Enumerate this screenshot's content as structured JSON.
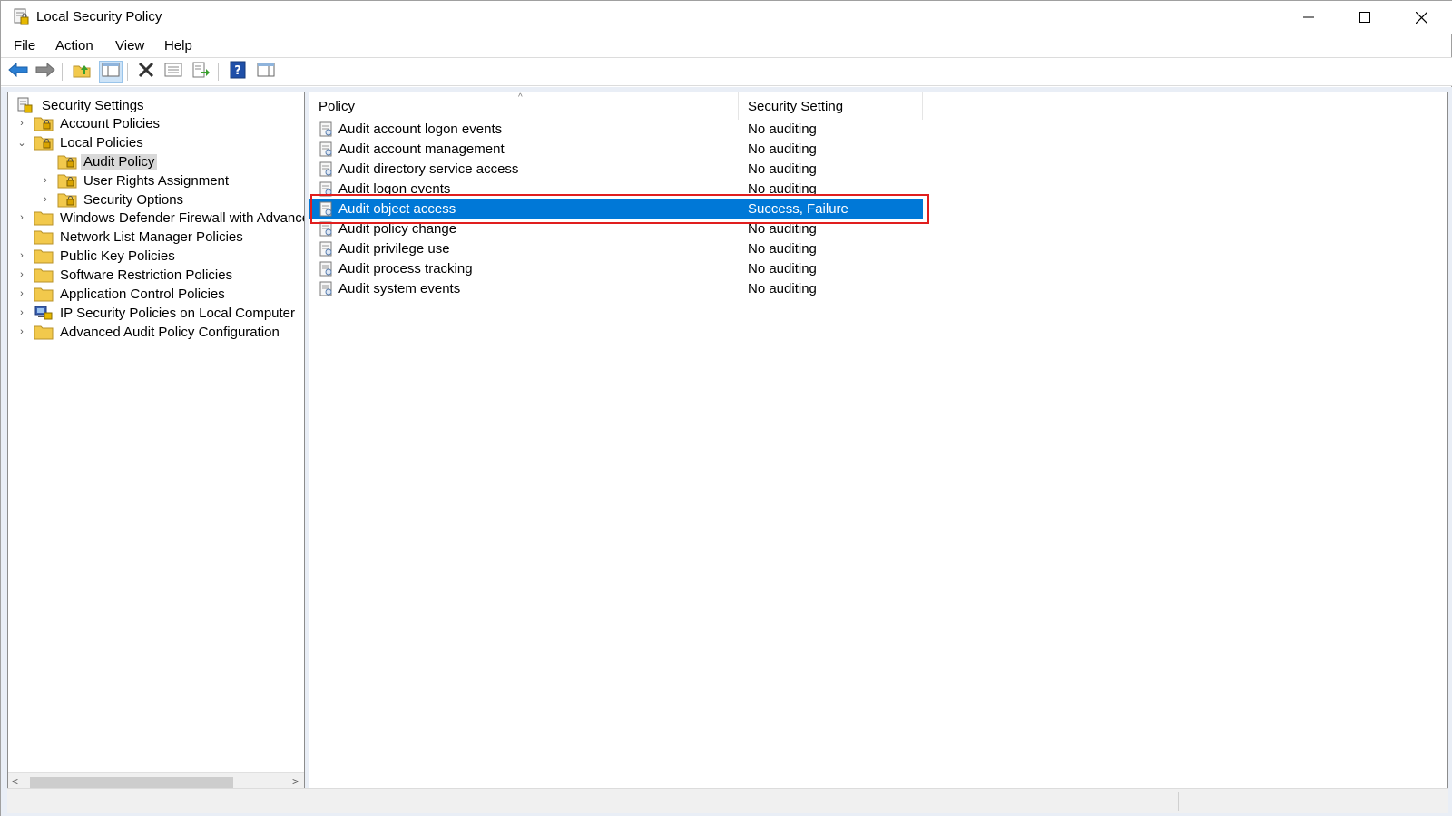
{
  "window": {
    "title": "Local Security Policy",
    "accent_color": "#0078d7",
    "highlight_color": "#e01e1e"
  },
  "menu": {
    "file": "File",
    "action": "Action",
    "view": "View",
    "help": "Help"
  },
  "toolbar": {
    "buttons": [
      "back-arrow-icon",
      "forward-arrow-icon",
      "up-folder-icon",
      "show-hide-console-tree-icon",
      "delete-icon",
      "properties-icon",
      "export-list-icon",
      "help-icon",
      "show-hide-action-pane-icon"
    ]
  },
  "tree": {
    "root": "Security Settings",
    "items": [
      {
        "label": "Account Policies",
        "expander": "›"
      },
      {
        "label": "Local Policies",
        "expander": "⌄"
      },
      {
        "label": "Audit Policy",
        "expander": ""
      },
      {
        "label": "User Rights Assignment",
        "expander": "›"
      },
      {
        "label": "Security Options",
        "expander": "›"
      },
      {
        "label": "Windows Defender Firewall with Advanced Security",
        "expander": "›"
      },
      {
        "label": "Network List Manager Policies",
        "expander": ""
      },
      {
        "label": "Public Key Policies",
        "expander": "›"
      },
      {
        "label": "Software Restriction Policies",
        "expander": "›"
      },
      {
        "label": "Application Control Policies",
        "expander": "›"
      },
      {
        "label": "IP Security Policies on Local Computer",
        "expander": "›"
      },
      {
        "label": "Advanced Audit Policy Configuration",
        "expander": "›"
      }
    ],
    "scroll_left": "<",
    "scroll_right": ">"
  },
  "list": {
    "columns": {
      "policy": "Policy",
      "setting": "Security Setting"
    },
    "sort_indicator": "^",
    "rows": [
      {
        "policy": "Audit account logon events",
        "setting": "No auditing"
      },
      {
        "policy": "Audit account management",
        "setting": "No auditing"
      },
      {
        "policy": "Audit directory service access",
        "setting": "No auditing"
      },
      {
        "policy": "Audit logon events",
        "setting": "No auditing"
      },
      {
        "policy": "Audit object access",
        "setting": "Success, Failure"
      },
      {
        "policy": "Audit policy change",
        "setting": "No auditing"
      },
      {
        "policy": "Audit privilege use",
        "setting": "No auditing"
      },
      {
        "policy": "Audit process tracking",
        "setting": "No auditing"
      },
      {
        "policy": "Audit system events",
        "setting": "No auditing"
      }
    ],
    "selected_row": "Audit object access"
  }
}
